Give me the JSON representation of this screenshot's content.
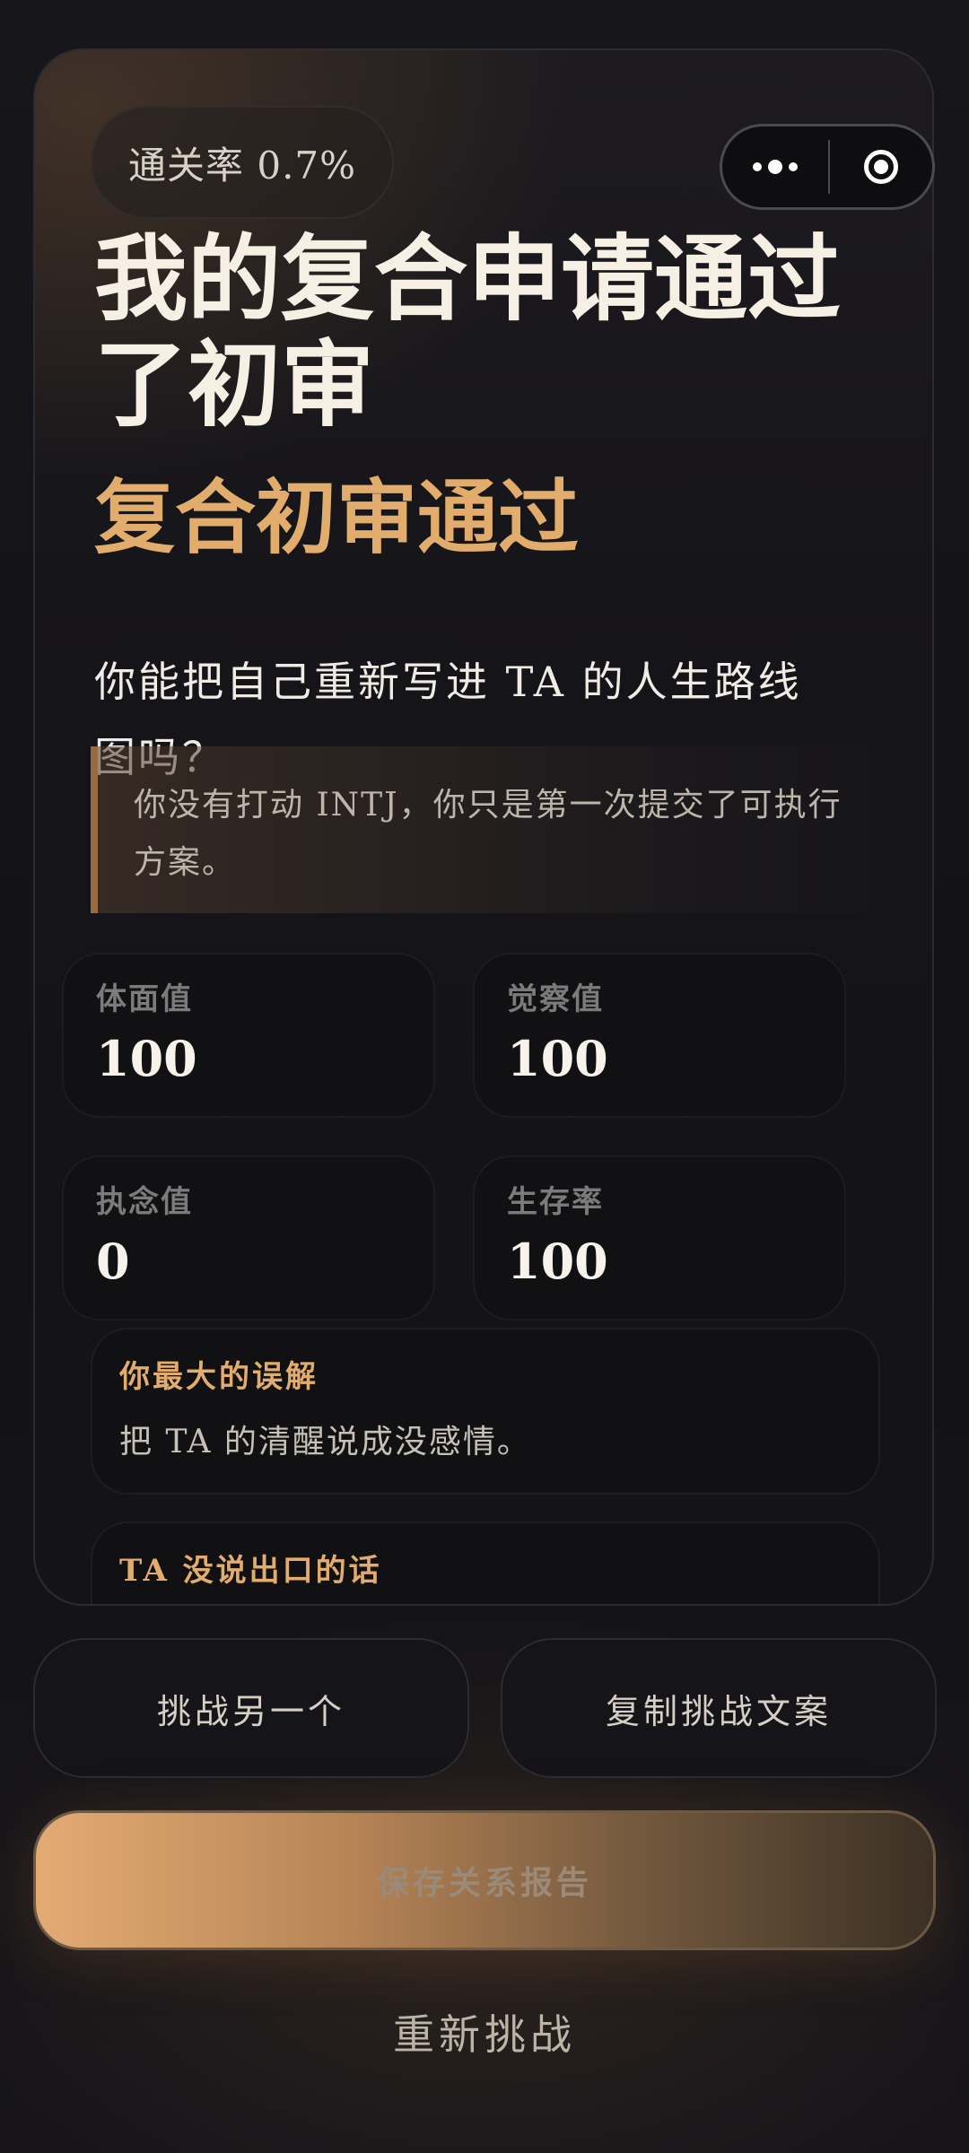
{
  "result": {
    "pass_rate": "通关率 0.7%",
    "title": "我的复合申请通过了初审",
    "subtitle": "复合初审通过",
    "question": "你能把自己重新写进 TA 的人生路线图吗？",
    "quote": "你没有打动 INTJ，你只是第一次提交了可执行方案。"
  },
  "stats": [
    {
      "label": "体面值",
      "value": "100"
    },
    {
      "label": "觉察值",
      "value": "100"
    },
    {
      "label": "执念值",
      "value": "0"
    },
    {
      "label": "生存率",
      "value": "100"
    }
  ],
  "sections": {
    "misunderstanding_heading": "你最大的误解",
    "misunderstanding_body": "把 TA 的清醒说成没感情。",
    "unsaid_heading": "TA 没说出口的话"
  },
  "actions": {
    "challenge_another": "挑战另一个",
    "copy_text": "复制挑战文案",
    "save_report": "保存关系报告",
    "retry": "重新挑战"
  },
  "capsule": {
    "more_icon": "more-dots-icon",
    "close_icon": "target-close-icon"
  },
  "colors": {
    "accent": "#e1ac6c",
    "background": "#121216"
  }
}
